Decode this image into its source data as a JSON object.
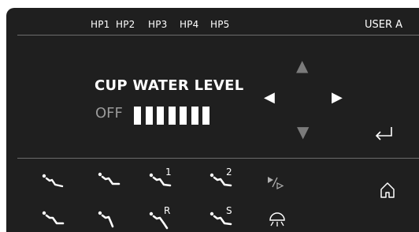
{
  "header": {
    "handpieces": [
      "HP1",
      "HP2",
      "HP3",
      "HP4",
      "HP5"
    ],
    "user": "USER A"
  },
  "main": {
    "title": "CUP WATER LEVEL",
    "state_label": "OFF",
    "level": {
      "filled": 7,
      "total": 7
    }
  },
  "navigation": {
    "up": {
      "icon": "arrow-up-icon",
      "enabled": false
    },
    "down": {
      "icon": "arrow-down-icon",
      "enabled": false
    },
    "left": {
      "icon": "arrow-left-icon",
      "enabled": true
    },
    "right": {
      "icon": "arrow-right-icon",
      "enabled": true
    },
    "enter": {
      "icon": "enter-return-icon"
    }
  },
  "tools": {
    "row1": [
      {
        "icon": "chair-position-icon"
      },
      {
        "icon": "chair-position-icon"
      },
      {
        "icon": "chair-memory-icon",
        "label": "1"
      },
      {
        "icon": "chair-memory-icon",
        "label": "2"
      },
      {
        "icon": "play-pause-icon"
      }
    ],
    "row2": [
      {
        "icon": "chair-position-icon"
      },
      {
        "icon": "chair-position-icon"
      },
      {
        "icon": "chair-memory-icon",
        "label": "R"
      },
      {
        "icon": "chair-memory-icon",
        "label": "S"
      },
      {
        "icon": "operating-light-icon"
      }
    ],
    "home": {
      "icon": "home-icon"
    }
  },
  "colors": {
    "panel": "#1f1f1f",
    "text": "#ffffff",
    "muted": "#9a9a9a",
    "disabled_arrow": "#7b7b7b",
    "divider": "#6c6c6c"
  }
}
